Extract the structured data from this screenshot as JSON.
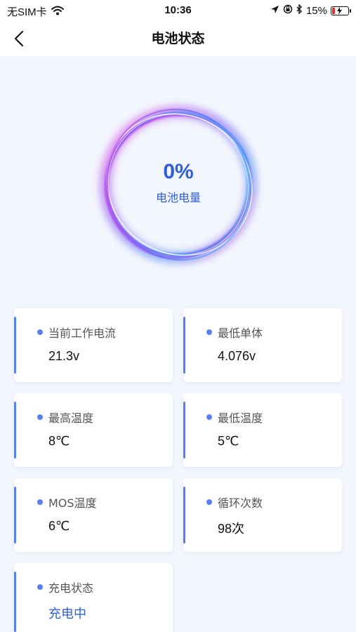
{
  "status_bar": {
    "carrier": "无SIM卡",
    "time": "10:36",
    "battery": "15%"
  },
  "nav": {
    "title": "电池状态"
  },
  "battery_ring": {
    "percent_text": "0%",
    "label": "电池电量"
  },
  "cards": [
    {
      "label": "当前工作电流",
      "value": "21.3v"
    },
    {
      "label": "最低单体",
      "value": "4.076v"
    },
    {
      "label": "最高温度",
      "value": "8℃"
    },
    {
      "label": "最低温度",
      "value": "5℃"
    },
    {
      "label": "MOS温度",
      "value": "6℃"
    },
    {
      "label": "循环次数",
      "value": "98次"
    },
    {
      "label": "充电状态",
      "value": "充电中"
    }
  ],
  "colors": {
    "accent": "#5b7ff0",
    "primary_text": "#2f5fd8",
    "background": "#f3f6fd",
    "battery_low": "#e0312b"
  }
}
